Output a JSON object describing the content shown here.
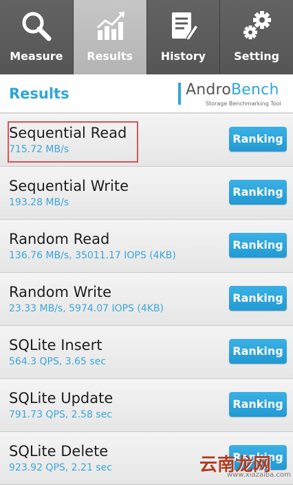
{
  "tabs": [
    {
      "label": "Measure",
      "icon": "search-icon",
      "active": false
    },
    {
      "label": "Results",
      "icon": "chart-icon",
      "active": true
    },
    {
      "label": "History",
      "icon": "history-icon",
      "active": false
    },
    {
      "label": "Setting",
      "icon": "gear-icon",
      "active": false
    }
  ],
  "header": {
    "title": "Results",
    "logo_name_a": "Andro",
    "logo_name_b": "Bench",
    "logo_tagline": "Storage Benchmarking Tool"
  },
  "results": [
    {
      "name": "Sequential Read",
      "value": "715.72 MB/s",
      "button": "Ranking"
    },
    {
      "name": "Sequential Write",
      "value": "193.28 MB/s",
      "button": "Ranking"
    },
    {
      "name": "Random Read",
      "value": "136.76 MB/s, 35011.17 IOPS (4KB)",
      "button": "Ranking"
    },
    {
      "name": "Random Write",
      "value": "23.33 MB/s, 5974.07 IOPS (4KB)",
      "button": "Ranking"
    },
    {
      "name": "SQLite Insert",
      "value": "564.3 QPS, 3.65 sec",
      "button": "Ranking"
    },
    {
      "name": "SQLite Update",
      "value": "791.73 QPS, 2.58 sec",
      "button": "Ranking"
    },
    {
      "name": "SQLite Delete",
      "value": "923.92 QPS, 2.21 sec",
      "button": "Ranking"
    }
  ],
  "watermark": {
    "cn": "云南龙网",
    "url": "www.xiazaiba.com"
  },
  "colors": {
    "accent": "#2fa6d8",
    "highlight": "#d9534f",
    "tabbar": "#5a5a5a"
  }
}
